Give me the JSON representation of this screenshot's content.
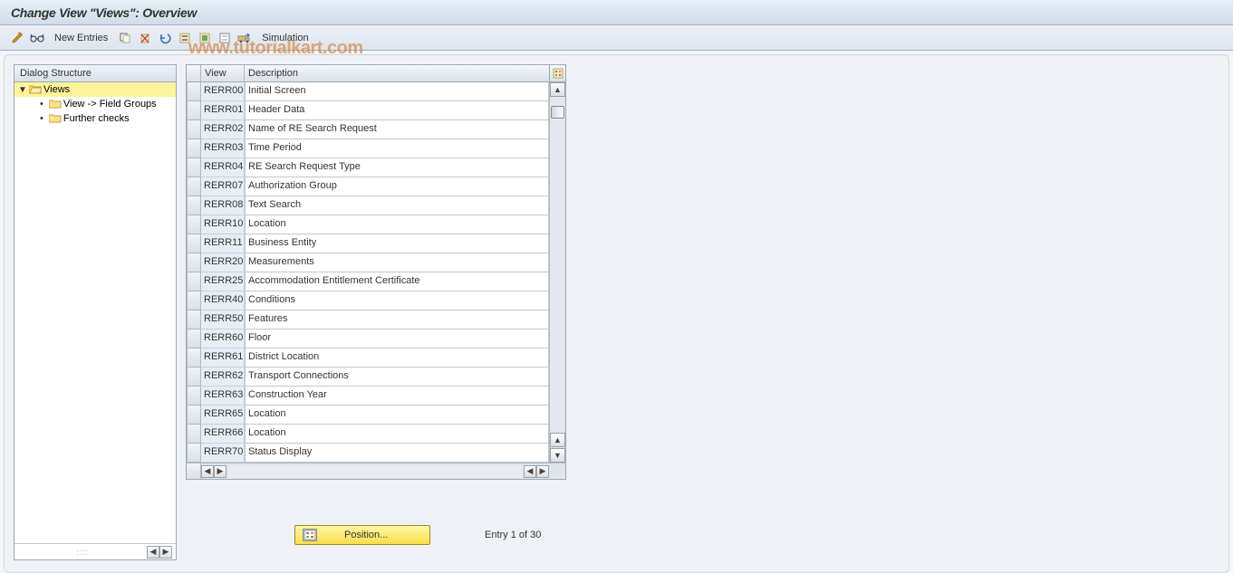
{
  "title": "Change View \"Views\": Overview",
  "toolbar": {
    "new_entries": "New Entries",
    "simulation": "Simulation"
  },
  "tree": {
    "header": "Dialog Structure",
    "root": "Views",
    "child1": "View -> Field Groups",
    "child2": "Further checks"
  },
  "table": {
    "col_view": "View",
    "col_desc": "Description",
    "rows": [
      {
        "view": "RERR00",
        "desc": "Initial Screen"
      },
      {
        "view": "RERR01",
        "desc": "Header Data"
      },
      {
        "view": "RERR02",
        "desc": "Name of RE Search Request"
      },
      {
        "view": "RERR03",
        "desc": "Time Period"
      },
      {
        "view": "RERR04",
        "desc": "RE Search Request Type"
      },
      {
        "view": "RERR07",
        "desc": "Authorization Group"
      },
      {
        "view": "RERR08",
        "desc": "Text Search"
      },
      {
        "view": "RERR10",
        "desc": "Location"
      },
      {
        "view": "RERR11",
        "desc": "Business Entity"
      },
      {
        "view": "RERR20",
        "desc": "Measurements"
      },
      {
        "view": "RERR25",
        "desc": "Accommodation Entitlement Certificate"
      },
      {
        "view": "RERR40",
        "desc": "Conditions"
      },
      {
        "view": "RERR50",
        "desc": "Features"
      },
      {
        "view": "RERR60",
        "desc": "Floor"
      },
      {
        "view": "RERR61",
        "desc": "District Location"
      },
      {
        "view": "RERR62",
        "desc": "Transport Connections"
      },
      {
        "view": "RERR63",
        "desc": "Construction Year"
      },
      {
        "view": "RERR65",
        "desc": "Location"
      },
      {
        "view": "RERR66",
        "desc": "Location"
      },
      {
        "view": "RERR70",
        "desc": "Status Display"
      }
    ]
  },
  "footer": {
    "position": "Position...",
    "entry": "Entry 1 of 30"
  },
  "icons": {
    "pencil": "pencil-icon",
    "glasses": "glasses-icon",
    "copy": "copy-icon",
    "delete": "delete-icon",
    "undo": "undo-icon",
    "select_all": "select-all-icon",
    "select_block": "select-block-icon",
    "deselect": "deselect-icon",
    "transport": "transport-icon"
  },
  "watermark": "www.tutorialkart.com"
}
